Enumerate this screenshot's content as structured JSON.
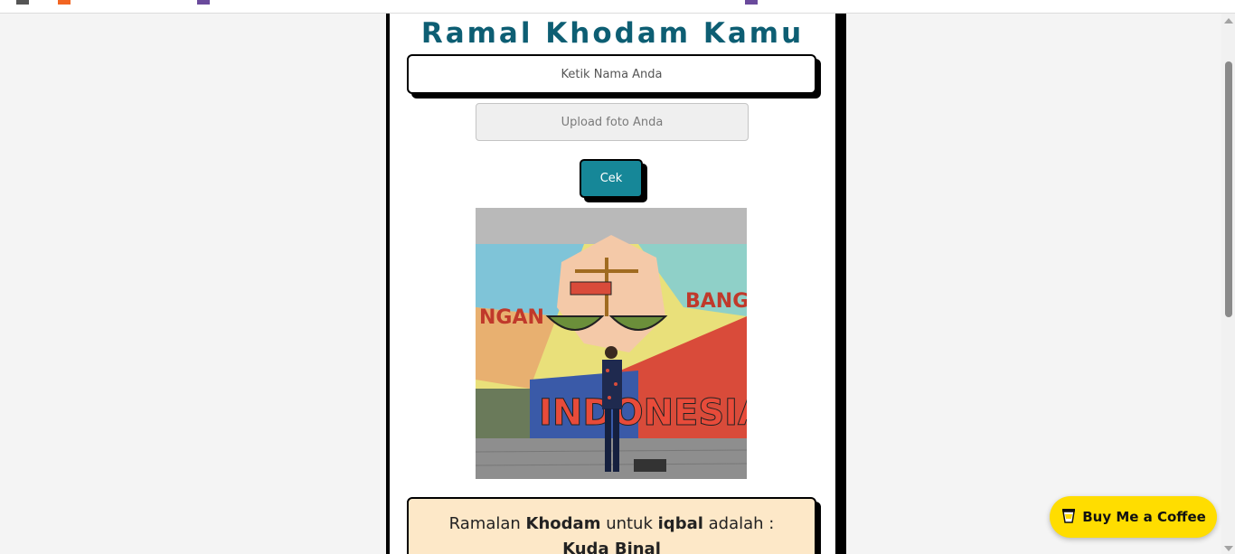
{
  "page": {
    "title": "Ramal Khodam Kamu"
  },
  "form": {
    "name_placeholder": "Ketik Nama Anda",
    "upload_label": "Upload foto Anda",
    "submit_label": "Cek"
  },
  "result": {
    "prefix": "Ramalan",
    "keyword": "Khodam",
    "middle": "untuk",
    "name": "iqbal",
    "suffix": "adalah :",
    "khodam": "Kuda Binal"
  },
  "photo": {
    "mural_text": "INDONESIA",
    "mural_text_left": "NGAN",
    "mural_text_right": "BANGK"
  },
  "coffee_button": {
    "label": "Buy Me a Coffee",
    "icon": "coffee-cup-icon"
  },
  "colors": {
    "title": "#0d5e73",
    "button": "#168798",
    "result_bg": "#fde8c8",
    "coffee_bg": "#ffdd00"
  }
}
